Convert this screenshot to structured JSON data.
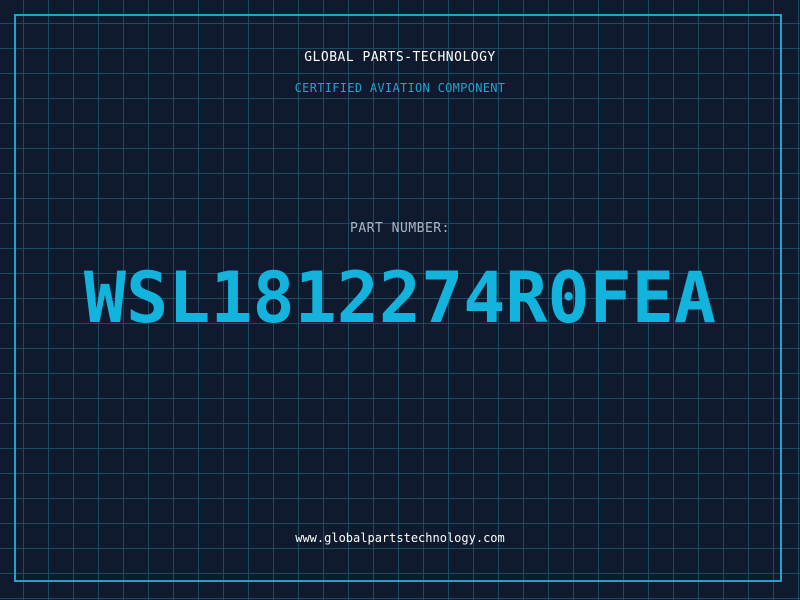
{
  "header": {
    "company": "GLOBAL PARTS-TECHNOLOGY",
    "subtitle": "CERTIFIED AVIATION COMPONENT"
  },
  "part": {
    "label": "PART NUMBER:",
    "number": "WSL1812274R0FEA"
  },
  "footer": {
    "url": "www.globalpartstechnology.com"
  },
  "colors": {
    "background": "#0f1a2e",
    "grid": "#1c4a5e",
    "accent": "#1fa3cf",
    "part_number": "#12b3dc",
    "text": "#ffffff",
    "label": "#aab6c8"
  }
}
